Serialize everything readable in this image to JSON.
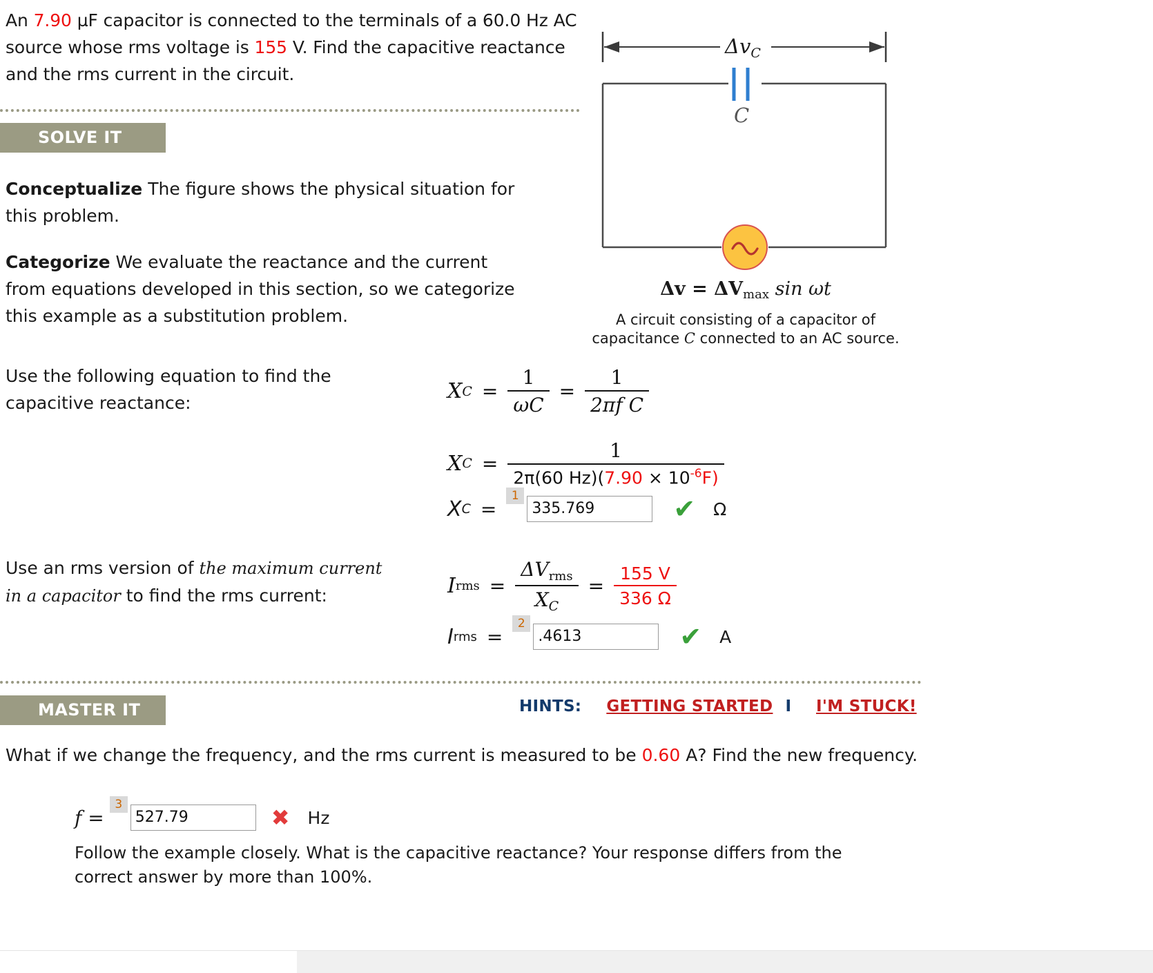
{
  "problem": {
    "text_before_c": "An ",
    "capacitance": "7.90",
    "text_mid": " µF capacitor is connected to the terminals of a 60.0 Hz AC source whose rms voltage is ",
    "voltage": "155",
    "text_after": " V. Find the capacitive reactance and the rms current in the circuit."
  },
  "sections": {
    "solve_it": "SOLVE IT",
    "master_it": "MASTER IT"
  },
  "conceptualize": {
    "lead": "Conceptualize",
    "body": " The figure shows the physical situation for this problem."
  },
  "categorize": {
    "lead": "Categorize",
    "body": " We evaluate the reactance and the current from equations developed in this section, so we categorize this example as a substitution problem."
  },
  "instructions": {
    "use_equation": "Use the following equation to find the capacitive reactance:",
    "use_rms_prefix": "Use an rms version of ",
    "use_rms_italic": "the maximum current in a capacitor",
    "use_rms_suffix": " to find the rms current:"
  },
  "figure": {
    "voltage_label": "Δv",
    "voltage_sub": "C",
    "capacitor_label": "C",
    "source_equation": "Δv = ΔV",
    "source_equation_sub": "max",
    "source_equation_tail": " sin ωt",
    "caption_line1": "A circuit consisting of a capacitor of",
    "caption_line2_a": "capacitance ",
    "caption_line2_italic": "C",
    "caption_line2_b": " connected to an AC source.",
    "capacitor_color": "#2f7fd0",
    "source_fill": "#fcc341",
    "source_stroke": "#d9534f",
    "wire_color": "#4a4a4a"
  },
  "equation_xc_symbolic": {
    "lhs": "X",
    "lhs_sub": "C",
    "eq1": "=",
    "frac1_num": "1",
    "frac1_den": "ωC",
    "eq2": "=",
    "frac2_num": "1",
    "frac2_den": "2πf C"
  },
  "equation_xc_numeric": {
    "lhs": "X",
    "lhs_sub": "C",
    "eq": "=",
    "num": "1",
    "den_part1": "2π(60 Hz)(",
    "den_cap": "7.90",
    "den_part2": " × 10",
    "den_exp": "-6",
    "den_part3": "F)"
  },
  "answer_xc": {
    "lhs": "X",
    "lhs_sub": "C",
    "eq": "=",
    "badge": "1",
    "value": "335.769",
    "status": "correct",
    "status_glyph": "✔",
    "unit": "Ω"
  },
  "equation_irms_symbolic": {
    "lhs": "I",
    "lhs_sub": "rms",
    "eq1": "=",
    "frac1_num": "ΔV",
    "frac1_num_sub": "rms",
    "frac1_den": "X",
    "frac1_den_sub": "C",
    "eq2": "=",
    "frac2_num": "155 V",
    "frac2_den": "336 Ω"
  },
  "answer_irms": {
    "lhs": "I",
    "lhs_sub": "rms",
    "eq": "=",
    "badge": "2",
    "value": ".4613",
    "status": "correct",
    "status_glyph": "✔",
    "unit": "A"
  },
  "hints": {
    "label": "HINTS:",
    "getting_started": "GETTING STARTED",
    "separator": "I",
    "im_stuck": "I'M STUCK!"
  },
  "master": {
    "question_before": "What if we change the frequency, and the rms current is measured to be ",
    "question_current": "0.60",
    "question_after": " A? Find the new frequency.",
    "f_label": "f =",
    "badge": "3",
    "value": "527.79",
    "status": "incorrect",
    "status_glyph": "✖",
    "unit": "Hz",
    "feedback": "Follow the example closely. What is the capacitive reactance? Your response differs from the correct answer by more than 100%."
  },
  "colors": {
    "highlight_red": "#ee1111",
    "tab_background": "#9b9b83",
    "correct_green": "#3aa03a",
    "incorrect_red": "#e23b3b",
    "hint_link": "#c12020",
    "hint_label": "#123a6b",
    "badge_text": "#cc6600"
  }
}
